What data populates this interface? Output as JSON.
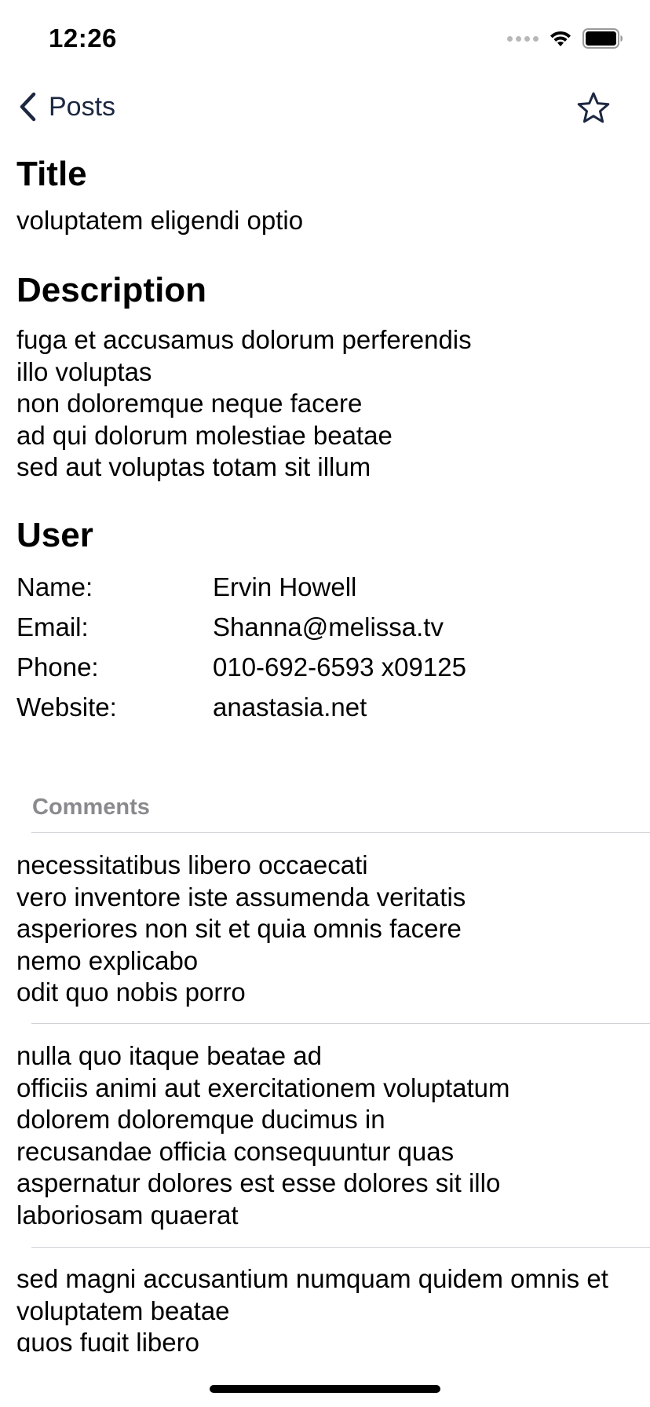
{
  "status_bar": {
    "time": "12:26",
    "icons": [
      "cellular-signal-icon",
      "wifi-icon",
      "battery-icon"
    ]
  },
  "nav": {
    "back_label": "Posts",
    "back_icon": "chevron-left-icon",
    "favorite_icon": "star-outline-icon",
    "accent_color": "#1c2741"
  },
  "post": {
    "title_heading": "Title",
    "title": "voluptatem eligendi optio",
    "description_heading": "Description",
    "description_lines": [
      "fuga et accusamus dolorum perferendis",
      "illo voluptas",
      "non doloremque neque facere",
      "ad qui dolorum molestiae beatae",
      "sed aut voluptas totam sit illum"
    ]
  },
  "user": {
    "heading": "User",
    "rows": [
      {
        "label": "Name:",
        "value": "Ervin Howell"
      },
      {
        "label": "Email:",
        "value": "Shanna@melissa.tv"
      },
      {
        "label": "Phone:",
        "value": "010-692-6593 x09125"
      },
      {
        "label": "Website:",
        "value": "anastasia.net"
      }
    ]
  },
  "comments": {
    "header": "Comments",
    "items": [
      {
        "lines": [
          "necessitatibus libero occaecati",
          "vero inventore iste assumenda veritatis",
          "asperiores non sit et quia omnis facere",
          "nemo explicabo",
          "odit quo nobis porro"
        ]
      },
      {
        "lines": [
          "nulla quo itaque beatae ad",
          "officiis animi aut exercitationem voluptatum",
          "dolorem doloremque ducimus in",
          "recusandae officia consequuntur quas",
          "aspernatur dolores est esse dolores sit illo",
          "laboriosam quaerat"
        ]
      },
      {
        "lines": [
          "sed magni accusantium numquam quidem omnis et",
          "voluptatem beatae",
          "quos fugit libero"
        ]
      }
    ]
  }
}
